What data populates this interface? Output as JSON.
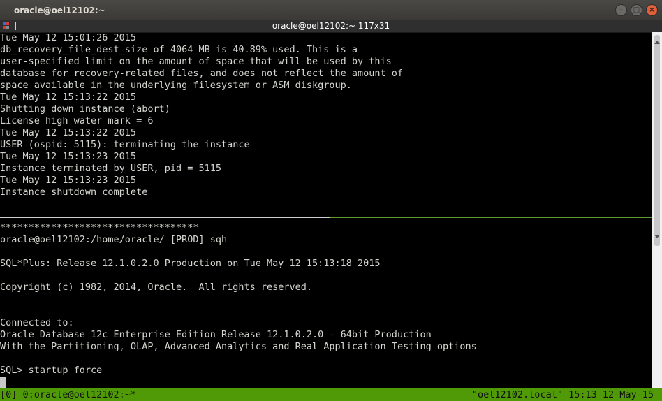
{
  "window": {
    "title": "oracle@oel12102:~",
    "buttons": {
      "minimize": "–",
      "maximize": "□",
      "close": "×"
    }
  },
  "tab_bar": {
    "title": "oracle@oel12102:~ 117x31"
  },
  "colors": {
    "accent": "#4f9a06",
    "terminal_bg": "#000000",
    "terminal_fg": "#d3d7cf"
  },
  "top_pane": {
    "lines": [
      "Tue May 12 15:01:26 2015",
      "db_recovery_file_dest_size of 4064 MB is 40.89% used. This is a",
      "user-specified limit on the amount of space that will be used by this",
      "database for recovery-related files, and does not reflect the amount of",
      "space available in the underlying filesystem or ASM diskgroup.",
      "Tue May 12 15:13:22 2015",
      "Shutting down instance (abort)",
      "License high water mark = 6",
      "Tue May 12 15:13:22 2015",
      "USER (ospid: 5115): terminating the instance",
      "Tue May 12 15:13:23 2015",
      "Instance terminated by USER, pid = 5115",
      "Tue May 12 15:13:23 2015",
      "Instance shutdown complete"
    ]
  },
  "bottom_pane": {
    "lines": [
      "***********************************",
      "oracle@oel12102:/home/oracle/ [PROD] sqh",
      "",
      "SQL*Plus: Release 12.1.0.2.0 Production on Tue May 12 15:13:18 2015",
      "",
      "Copyright (c) 1982, 2014, Oracle.  All rights reserved.",
      "",
      "",
      "Connected to:",
      "Oracle Database 12c Enterprise Edition Release 12.1.0.2.0 - 64bit Production",
      "With the Partitioning, OLAP, Advanced Analytics and Real Application Testing options",
      "",
      "SQL> startup force"
    ]
  },
  "status_bar": {
    "left": "[0] 0:oracle@oel12102:~*",
    "right": "\"oel12102.local\" 15:13 12-May-15"
  }
}
